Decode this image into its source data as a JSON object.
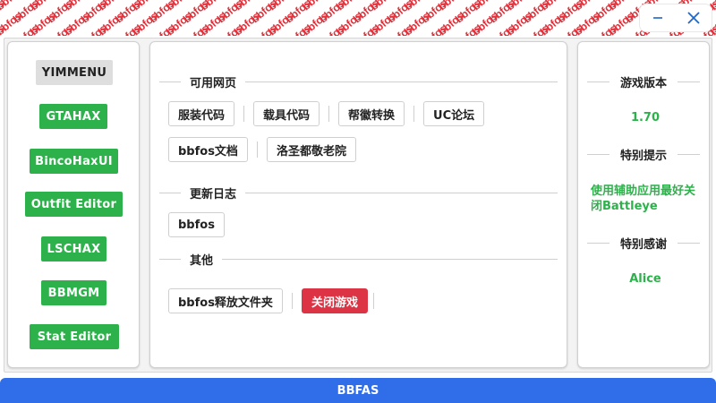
{
  "banner": {
    "pattern_text": "bbfos",
    "pattern_color": "#e0303a"
  },
  "window": {
    "minimize_icon": "minimize-icon",
    "close_icon": "close-icon",
    "icon_color": "#1e66c8"
  },
  "sidebar": {
    "items": [
      {
        "label": "YIMMENU",
        "style": "gray"
      },
      {
        "label": "GTAHAX",
        "style": "green"
      },
      {
        "label": "BincoHaxUI",
        "style": "green"
      },
      {
        "label": "Outfit Editor",
        "style": "green"
      },
      {
        "label": "LSCHAX",
        "style": "green"
      },
      {
        "label": "BBMGM",
        "style": "green"
      },
      {
        "label": "Stat Editor",
        "style": "green"
      }
    ]
  },
  "main": {
    "sections": [
      {
        "title": "可用网页"
      },
      {
        "title": "更新日志"
      },
      {
        "title": "其他"
      }
    ],
    "links_row1": [
      "服装代码",
      "载具代码",
      "帮徽转换",
      "UC论坛"
    ],
    "links_row2": [
      "bbfos文档",
      "洛圣都敬老院"
    ],
    "log_row": [
      "bbfos"
    ],
    "other_row": {
      "open_folder": "bbfos释放文件夹",
      "close_game": "关闭游戏"
    }
  },
  "right": {
    "version_title": "游戏版本",
    "version_value": "1.70",
    "tip_title": "特别提示",
    "tip_text": "使用辅助应用最好关闭Battleye",
    "thanks_title": "特别感谢",
    "thanks_value": "Alice"
  },
  "footer": {
    "label": "BBFAS"
  },
  "colors": {
    "green": "#2db14a",
    "red": "#dc3444",
    "blue": "#2f6ee8",
    "gray": "#dedede"
  }
}
